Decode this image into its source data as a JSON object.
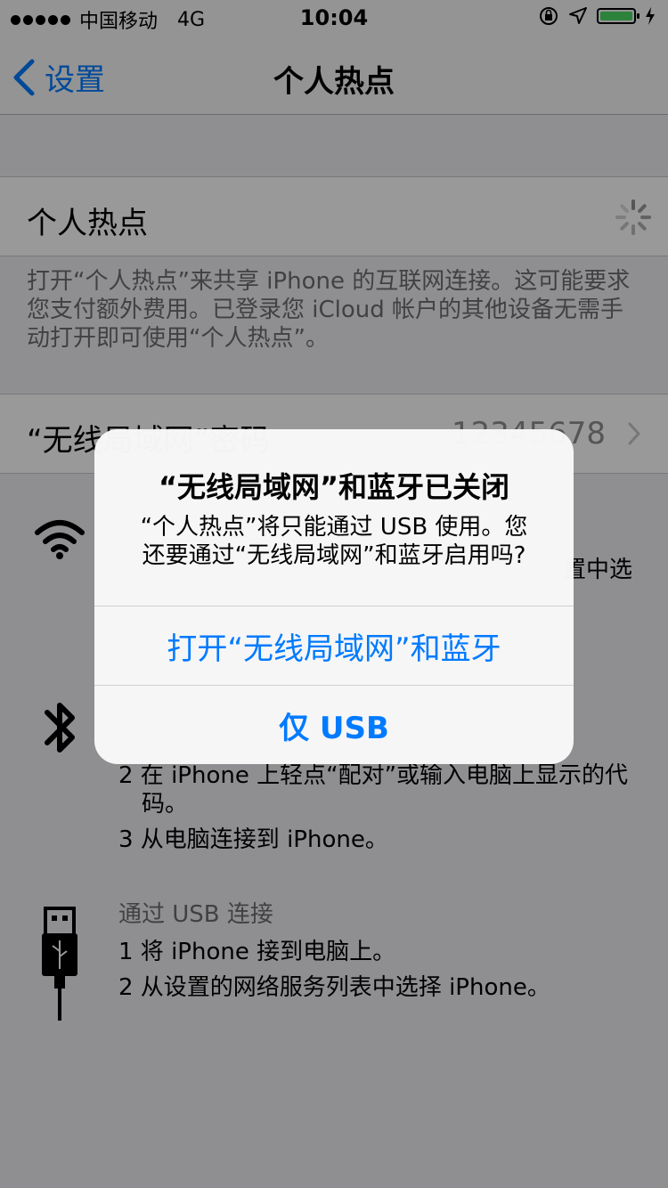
{
  "status_bar": {
    "carrier": "中国移动",
    "network": "4G",
    "time": "10:04",
    "battery_percent": 100
  },
  "nav": {
    "back_label": "设置",
    "title": "个人热点"
  },
  "hotspot": {
    "toggle_label": "个人热点",
    "description": "打开“个人热点”来共享 iPhone 的互联网连接。这可能要求您支付额外费用。已登录您 iCloud 帐户的其他设备无需手动打开即可使用“个人热点”。"
  },
  "wifi_password": {
    "label": "“无线局域网”密码",
    "value": "12345678"
  },
  "wifi_section": {
    "partial_text": "置中选"
  },
  "bluetooth_section": {
    "lines": [
      "2 在 iPhone 上轻点“配对”或输入电脑上显示的代码。",
      "3 从电脑连接到 iPhone。"
    ]
  },
  "usb_section": {
    "heading": "通过 USB 连接",
    "lines": [
      "1 将 iPhone 接到电脑上。",
      "2 从设置的网络服务列表中选择 iPhone。"
    ]
  },
  "alert": {
    "title": "“无线局域网”和蓝牙已关闭",
    "message": "“个人热点”将只能通过 USB 使用。您还要通过“无线局域网”和蓝牙启用吗?",
    "primary_button": "打开“无线局域网”和蓝牙",
    "secondary_button": "仅 USB"
  },
  "colors": {
    "accent": "#007aff",
    "battery": "#4cd964",
    "secondary_text": "#6d6d72"
  }
}
